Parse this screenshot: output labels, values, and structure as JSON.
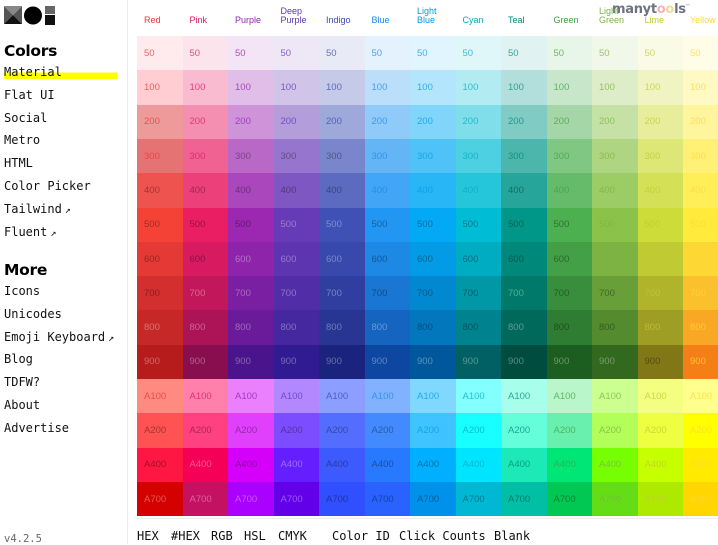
{
  "sidebar": {
    "logo": "MUI logo",
    "sections": [
      {
        "title": "Colors",
        "items": [
          {
            "label": "Material",
            "active": true,
            "external": false
          },
          {
            "label": "Flat UI",
            "external": false
          },
          {
            "label": "Social",
            "external": false
          },
          {
            "label": "Metro",
            "external": false
          },
          {
            "label": "HTML",
            "external": false
          },
          {
            "label": "Color Picker",
            "external": false
          },
          {
            "label": "Tailwind",
            "external": true
          },
          {
            "label": "Fluent",
            "external": true
          }
        ]
      },
      {
        "title": "More",
        "items": [
          {
            "label": "Icons",
            "external": false
          },
          {
            "label": "Unicodes",
            "external": false
          },
          {
            "label": "Emoji Keyboard",
            "external": true
          },
          {
            "label": "Blog",
            "external": false
          },
          {
            "label": "TDFW?",
            "external": false
          },
          {
            "label": "About",
            "external": false
          },
          {
            "label": "Advertise",
            "external": false
          }
        ]
      }
    ],
    "external_icon": "↗",
    "version": "v4.2.5"
  },
  "watermark": {
    "text": "manytools",
    "tm": "™"
  },
  "palette": {
    "shades": [
      "50",
      "100",
      "200",
      "300",
      "400",
      "500",
      "600",
      "700",
      "800",
      "900",
      "A100",
      "A200",
      "A400",
      "A700"
    ],
    "columns": [
      {
        "name": "Red",
        "header_color": "#e53935",
        "colors": [
          "#ffebee",
          "#ffcdd2",
          "#ef9a9a",
          "#e57373",
          "#ef5350",
          "#f44336",
          "#e53935",
          "#d32f2f",
          "#c62828",
          "#b71c1c",
          "#ff8a80",
          "#ff5252",
          "#ff1744",
          "#d50000"
        ]
      },
      {
        "name": "Pink",
        "header_color": "#d81b60",
        "colors": [
          "#fce4ec",
          "#f8bbd0",
          "#f48fb1",
          "#f06292",
          "#ec407a",
          "#e91e63",
          "#d81b60",
          "#c2185b",
          "#ad1457",
          "#880e4f",
          "#ff80ab",
          "#ff4081",
          "#f50057",
          "#c51162"
        ]
      },
      {
        "name": "Purple",
        "header_color": "#8e24aa",
        "colors": [
          "#f3e5f5",
          "#e1bee7",
          "#ce93d8",
          "#ba68c8",
          "#ab47bc",
          "#9c27b0",
          "#8e24aa",
          "#7b1fa2",
          "#6a1b9a",
          "#4a148c",
          "#ea80fc",
          "#e040fb",
          "#d500f9",
          "#aa00ff"
        ]
      },
      {
        "name": "Deep Purple",
        "header_color": "#5e35b1",
        "colors": [
          "#ede7f6",
          "#d1c4e9",
          "#b39ddb",
          "#9575cd",
          "#7e57c2",
          "#673ab7",
          "#5e35b1",
          "#512da8",
          "#4527a0",
          "#311b92",
          "#b388ff",
          "#7c4dff",
          "#651fff",
          "#6200ea"
        ]
      },
      {
        "name": "Indigo",
        "header_color": "#3949ab",
        "colors": [
          "#e8eaf6",
          "#c5cae9",
          "#9fa8da",
          "#7986cb",
          "#5c6bc0",
          "#3f51b5",
          "#3949ab",
          "#303f9f",
          "#283593",
          "#1a237e",
          "#8c9eff",
          "#536dfe",
          "#3d5afe",
          "#304ffe"
        ]
      },
      {
        "name": "Blue",
        "header_color": "#1e88e5",
        "colors": [
          "#e3f2fd",
          "#bbdefb",
          "#90caf9",
          "#64b5f6",
          "#42a5f5",
          "#2196f3",
          "#1e88e5",
          "#1976d2",
          "#1565c0",
          "#0d47a1",
          "#82b1ff",
          "#448aff",
          "#2979ff",
          "#2962ff"
        ]
      },
      {
        "name": "Light Blue",
        "header_color": "#039be5",
        "colors": [
          "#e1f5fe",
          "#b3e5fc",
          "#81d4fa",
          "#4fc3f7",
          "#29b6f6",
          "#03a9f4",
          "#039be5",
          "#0288d1",
          "#0277bd",
          "#01579b",
          "#80d8ff",
          "#40c4ff",
          "#00b0ff",
          "#0091ea"
        ]
      },
      {
        "name": "Cyan",
        "header_color": "#00acc1",
        "colors": [
          "#e0f7fa",
          "#b2ebf2",
          "#80deea",
          "#4dd0e1",
          "#26c6da",
          "#00bcd4",
          "#00acc1",
          "#0097a7",
          "#00838f",
          "#006064",
          "#84ffff",
          "#18ffff",
          "#00e5ff",
          "#00b8d4"
        ]
      },
      {
        "name": "Teal",
        "header_color": "#00897b",
        "colors": [
          "#e0f2f1",
          "#b2dfdb",
          "#80cbc4",
          "#4db6ac",
          "#26a69a",
          "#009688",
          "#00897b",
          "#00796b",
          "#00695c",
          "#004d40",
          "#a7ffeb",
          "#64ffda",
          "#1de9b6",
          "#00bfa5"
        ]
      },
      {
        "name": "Green",
        "header_color": "#43a047",
        "colors": [
          "#e8f5e9",
          "#c8e6c9",
          "#a5d6a7",
          "#81c784",
          "#66bb6a",
          "#4caf50",
          "#43a047",
          "#388e3c",
          "#2e7d32",
          "#1b5e20",
          "#b9f6ca",
          "#69f0ae",
          "#00e676",
          "#00c853"
        ]
      },
      {
        "name": "Light Green",
        "header_color": "#7cb342",
        "colors": [
          "#f1f8e9",
          "#dcedc8",
          "#c5e1a5",
          "#aed581",
          "#9ccc65",
          "#8bc34a",
          "#7cb342",
          "#689f38",
          "#558b2f",
          "#33691e",
          "#ccff90",
          "#b2ff59",
          "#76ff03",
          "#64dd17"
        ]
      },
      {
        "name": "Lime",
        "header_color": "#c0ca33",
        "colors": [
          "#f9fbe7",
          "#f0f4c3",
          "#e6ee9c",
          "#dce775",
          "#d4e157",
          "#cddc39",
          "#c0ca33",
          "#afb42b",
          "#9e9d24",
          "#827717",
          "#f4ff81",
          "#eeff41",
          "#c6ff00",
          "#aeea00"
        ]
      },
      {
        "name": "Yellow",
        "header_color": "#fdd835",
        "colors": [
          "#fffde7",
          "#fff9c4",
          "#fff59d",
          "#fff176",
          "#ffee58",
          "#ffeb3b",
          "#fdd835",
          "#fbc02d",
          "#f9a825",
          "#f57f17",
          "#ffff8d",
          "#ffff00",
          "#ffea00",
          "#ffd600"
        ]
      }
    ]
  },
  "footer": {
    "buttons": [
      "HEX",
      "#HEX",
      "RGB",
      "HSL",
      "CMYK",
      "Color ID",
      "Click Counts",
      "Blank"
    ]
  }
}
